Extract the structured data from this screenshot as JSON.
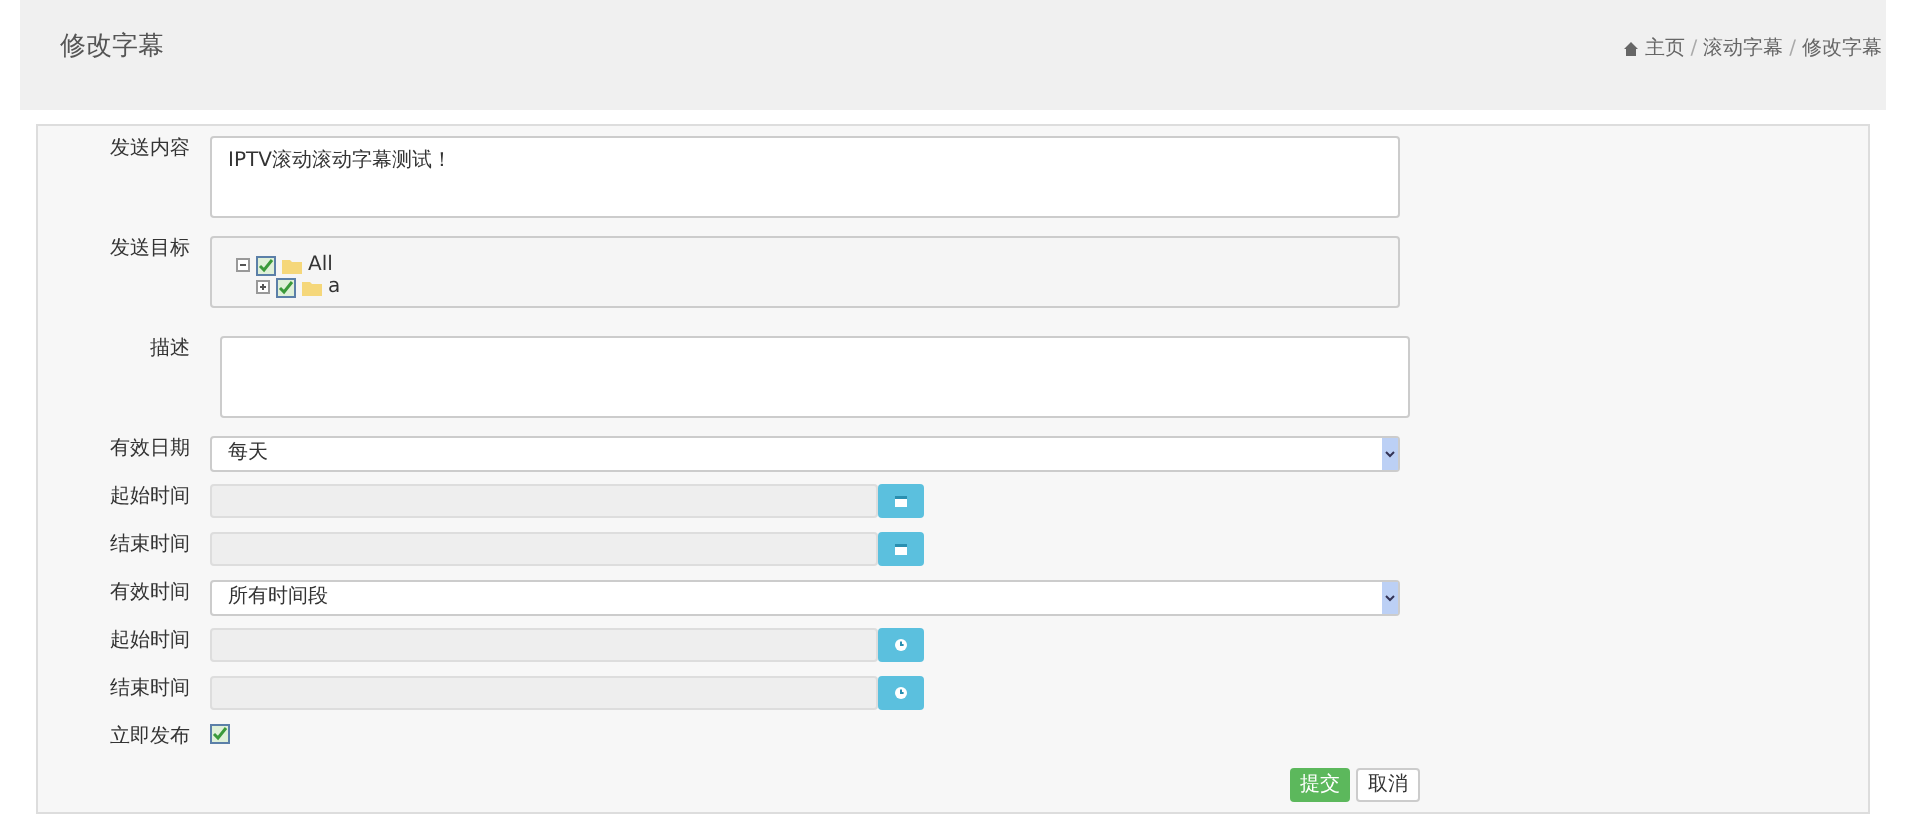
{
  "page_title": "修改字幕",
  "breadcrumb": [
    "主页",
    "滚动字幕",
    "修改字幕"
  ],
  "breadcrumb_separator": "/",
  "fields": [
    {
      "kind": "textarea",
      "label": "发送内容",
      "value": "IPTV滚动滚动字幕测试！"
    },
    {
      "kind": "tree",
      "label": "发送目标",
      "tree": [
        {
          "label": "All",
          "checked": true,
          "expanded": true,
          "children": [
            {
              "label": "a",
              "checked": true,
              "expanded": false
            }
          ]
        }
      ]
    },
    {
      "kind": "textarea",
      "label": "描述"
    },
    {
      "kind": "select",
      "label": "有效日期",
      "value": "每天"
    },
    {
      "kind": "date",
      "label": "起始时间",
      "disabled": true
    },
    {
      "kind": "date",
      "label": "结束时间",
      "disabled": true
    },
    {
      "kind": "select",
      "label": "有效时间",
      "value": "所有时间段"
    },
    {
      "kind": "time",
      "label": "起始时间",
      "disabled": true
    },
    {
      "kind": "time",
      "label": "结束时间",
      "disabled": true
    },
    {
      "kind": "checkbox",
      "label": "立即发布",
      "checked": true
    }
  ],
  "buttons": [
    {
      "label": "提交",
      "kind": "primary"
    },
    {
      "label": "取消",
      "kind": "default"
    }
  ]
}
